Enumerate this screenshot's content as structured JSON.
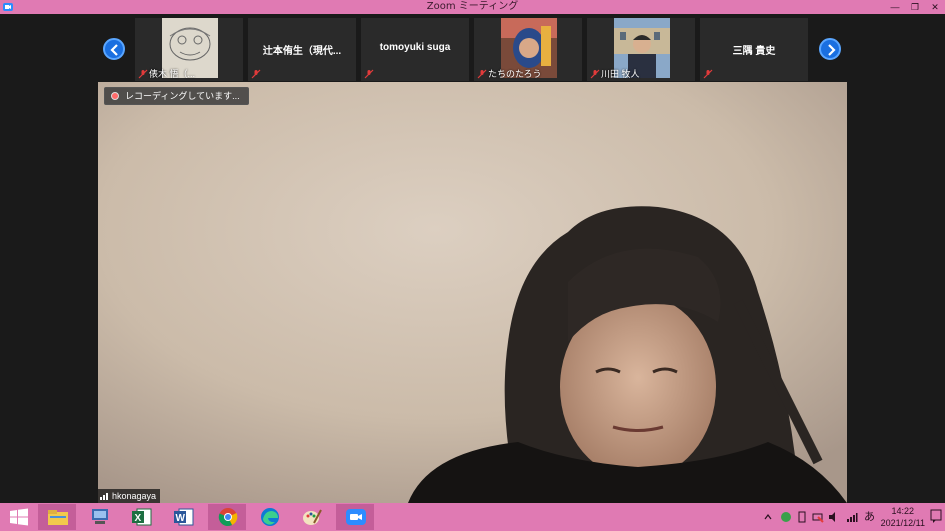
{
  "window": {
    "title": "Zoom ミーティング",
    "minimize_glyph": "—",
    "restore_glyph": "❐",
    "close_glyph": "✕"
  },
  "gallery": {
    "prev_icon": "chevron-left-icon",
    "next_icon": "chevron-right-icon",
    "tiles": [
      {
        "label": "俵木 悟（...",
        "name": "",
        "has_video": true
      },
      {
        "label": "",
        "name": "辻本侑生（現代...",
        "has_video": false
      },
      {
        "label": "",
        "name": "tomoyuki suga",
        "has_video": false
      },
      {
        "label": "たちのたろう",
        "name": "",
        "has_video": true
      },
      {
        "label": "川田 牧人",
        "name": "",
        "has_video": true
      },
      {
        "label": "",
        "name": "三隅 貴史",
        "has_video": false
      }
    ]
  },
  "main_video": {
    "recording_label": "レコーディングしています...",
    "speaker_name": "hkonagaya"
  },
  "taskbar": {
    "apps": [
      {
        "name": "start",
        "icon": "windows-icon"
      },
      {
        "name": "file-explorer",
        "icon": "folder-icon"
      },
      {
        "name": "app2",
        "icon": "monitor-icon"
      },
      {
        "name": "excel",
        "icon": "excel-icon"
      },
      {
        "name": "word",
        "icon": "word-icon"
      },
      {
        "name": "chrome",
        "icon": "chrome-icon"
      },
      {
        "name": "edge",
        "icon": "edge-icon"
      },
      {
        "name": "paint",
        "icon": "paint-icon"
      },
      {
        "name": "zoom",
        "icon": "zoom-icon"
      }
    ],
    "ime_label": "あ",
    "time": "14:22",
    "date": "2021/12/11"
  },
  "colors": {
    "accent": "#e07ab3",
    "zoom_blue": "#1a6fe0",
    "muted_red": "#e23b3b"
  }
}
